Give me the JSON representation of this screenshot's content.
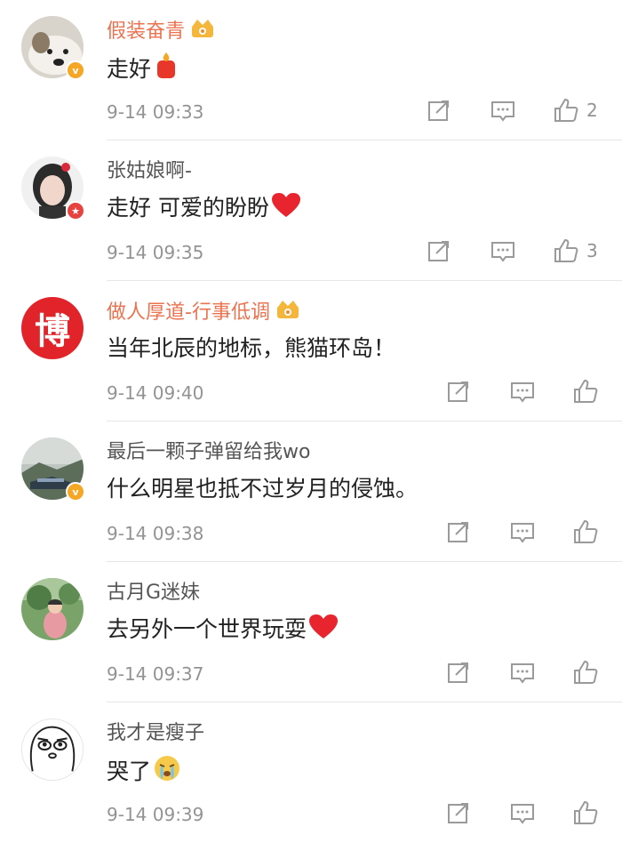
{
  "colors": {
    "vip_name": "#eb7350",
    "normal_name": "#555555",
    "text": "#222222",
    "meta": "#939393",
    "divider": "#e6e6e6"
  },
  "comments": [
    {
      "username": "假装奋青",
      "vip": true,
      "verified": "yellow-v",
      "text": "走好",
      "emoji": "candle-icon",
      "time": "9-14 09:33",
      "likes": "2",
      "avatar": "dog-avatar"
    },
    {
      "username": "张姑娘啊-",
      "vip": false,
      "verified": "red-star",
      "text": "走好 可爱的盼盼",
      "emoji": "heart-icon",
      "time": "9-14 09:35",
      "likes": "3",
      "avatar": "girl-avatar"
    },
    {
      "username": "做人厚道-行事低调",
      "vip": true,
      "verified": "",
      "text": "当年北辰的地标，熊猫环岛！",
      "emoji": "",
      "time": "9-14 09:40",
      "likes": "",
      "avatar": "bo-character-avatar",
      "avatar_char": "博"
    },
    {
      "username": "最后一颗子弹留给我wo",
      "vip": false,
      "verified": "yellow-v",
      "text": "什么明星也抵不过岁月的侵蚀。",
      "emoji": "",
      "time": "9-14 09:38",
      "likes": "",
      "avatar": "landscape-avatar"
    },
    {
      "username": "古月G迷妹",
      "vip": false,
      "verified": "",
      "text": "去另外一个世界玩耍",
      "emoji": "heart-icon",
      "time": "9-14 09:37",
      "likes": "",
      "avatar": "outdoor-avatar"
    },
    {
      "username": "我才是瘦子",
      "vip": false,
      "verified": "",
      "text": "哭了",
      "emoji": "crying-face-icon",
      "time": "9-14 09:39",
      "likes": "",
      "avatar": "cartoon-face-avatar"
    }
  ]
}
